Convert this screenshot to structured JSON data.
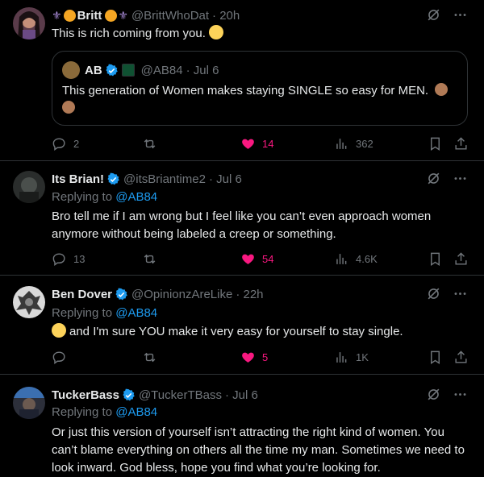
{
  "tweets": [
    {
      "name": "Britt",
      "handle": "@BrittWhoDat",
      "time": "· 20h",
      "text": "This is rich coming from you.",
      "quote": {
        "name": "AB",
        "handle": "@AB84",
        "time": "· Jul 6",
        "text": "This generation of Women makes staying SINGLE so easy for MEN."
      },
      "replies": "2",
      "likes": "14",
      "views": "362"
    },
    {
      "name": "Its Brian!",
      "handle": "@itsBriantime2",
      "time": "· Jul 6",
      "replying_prefix": "Replying to",
      "replying_to": "@AB84",
      "text": "Bro tell me if I am wrong but I feel like you can’t even approach women anymore without being labeled a creep or something.",
      "replies": "13",
      "likes": "54",
      "views": "4.6K"
    },
    {
      "name": "Ben Dover",
      "handle": "@OpinionzAreLike",
      "time": "· 22h",
      "replying_prefix": "Replying to",
      "replying_to": "@AB84",
      "text": "and I'm sure YOU make it very easy for yourself to stay single.",
      "replies": "",
      "likes": "5",
      "views": "1K"
    },
    {
      "name": "TuckerBass",
      "handle": "@TuckerTBass",
      "time": "· Jul 6",
      "replying_prefix": "Replying to",
      "replying_to": "@AB84",
      "text": "Or just this version of yourself isn’t attracting the right kind of women. You can’t blame everything on others all the time my man. Sometimes we need to look inward. God bless, hope you find what you’re looking for."
    }
  ],
  "colors": {
    "background": "#000000",
    "text": "#e7e9ea",
    "muted": "#71767b",
    "link": "#1d9bf0",
    "like": "#f91880",
    "border": "#2f3336"
  }
}
